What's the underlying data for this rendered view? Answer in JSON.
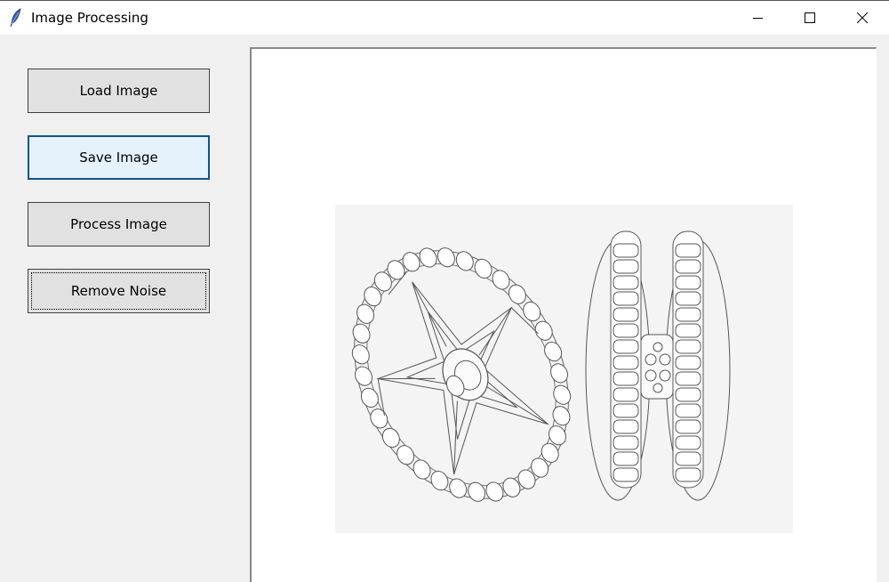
{
  "window": {
    "title": "Image Processing",
    "app_icon": "feather-icon",
    "controls": {
      "minimize_icon": "minimize-icon",
      "maximize_icon": "maximize-icon",
      "close_icon": "close-icon"
    }
  },
  "sidebar": {
    "buttons": [
      {
        "label": "Load Image"
      },
      {
        "label": "Save Image"
      },
      {
        "label": "Process Image"
      },
      {
        "label": "Remove Noise"
      }
    ]
  },
  "canvas": {
    "image_subject": "wheel-line-drawing"
  },
  "colors": {
    "window_bg": "#f0f0f0",
    "button_bg": "#e1e1e1",
    "button_hover_bg": "#e5f1fb",
    "button_hover_border": "#0c5392",
    "canvas_bg": "#ffffff",
    "image_bg": "#f4f4f4"
  }
}
